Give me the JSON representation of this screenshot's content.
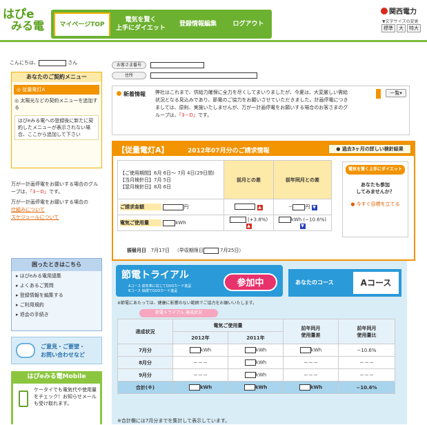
{
  "header": {
    "logo_line1": "はぴe",
    "logo_line2": "みる電",
    "nav": [
      "マイページTOP",
      "電気を賢く\n上手にダイエット",
      "登録情報編集",
      "ログアウト"
    ],
    "brand": "関西電力",
    "font_size_label": "文字サイズの変更",
    "font_sizes": [
      "標準",
      "大",
      "特大"
    ]
  },
  "sidebar": {
    "greeting_prefix": "こんにちは、",
    "greeting_suffix": "さん",
    "menu_title": "あなたのご契約メニュー",
    "menu_selected": "従量電灯A",
    "menu_items": [
      "太陽光などの契約メニューを追加する",
      "はぴeみる電への登録後に新たに契約したメニューが表示されない場合、ここから追加して下さい"
    ],
    "notice1": "万が一計画停電をお願いする場合のグループは、",
    "notice_group": "「3－D」",
    "notice1_end": "です。",
    "notice2": "万が一計画停電をお願いする場合の",
    "notice2_link1": "仕組みについて",
    "notice2_link2": "スケジュールについて",
    "trouble_title": "困ったときはこちら",
    "trouble_items": [
      "はぴeみる電用語集",
      "よくあるご質問",
      "登録情報を編集する",
      "ご利用規約",
      "退会の手続き"
    ],
    "contact": "ご意見・ご要望・\nお問い合わせなど",
    "mobile_title": "はぴeみる電Mobile",
    "mobile_text": "ケータイでも電気代や使用量をチェック！お知らせメールも受け取れます。"
  },
  "info": {
    "customer_no_label": "お客さま番号",
    "address_label": "住所"
  },
  "news": {
    "title": "新着情報",
    "body": "弊社はこれまで、供給力確保に全力を尽くしてまいりましたが、今夏は、大変厳しい需給状況となる見込みであり、節電のご協力をお願いさせていただきました。計画停電につきましては、原則、実施いたしませんが、万が一計画停電をお願いする場合のお客さまのグループは、",
    "body_group": "「3－D」",
    "body_end": "です。",
    "list_button": "一覧"
  },
  "bill": {
    "plan": "【従量電灯A】",
    "title": "2012年07月分のご請求情報",
    "history_button": "過去3ヶ月の詳しい検針結果",
    "period": "【ご使用期間】6月 6日～ 7月 4日(29日間)",
    "meter_date": "【当月検針日】7月 5日",
    "next_meter": "【翌月検針日】8月 6日",
    "col_prev": "前月との差",
    "col_prev_year": "前年同月との差",
    "row_amount": "ご請求金額",
    "row_usage": "電気ご使用量",
    "unit_yen": "円",
    "unit_kwh": "kWh",
    "usage_prev_pct": "(+3.8%)",
    "usage_year_pct": "(−10.6%)",
    "amount_year_prefix": "－",
    "payment_label": "振替月日",
    "payment_date": "7月17日",
    "early_label": "（早収期限日",
    "early_date": "7月25日）",
    "diet_button": "電気を賢く上手にダイエット",
    "diet_q": "あなたも参加\nしてみませんか？",
    "diet_link": "今すぐ目標を立てる"
  },
  "trial": {
    "title": "節電トライアル",
    "course_a": "Aコース 前年率に応じてQUOカード進呈",
    "course_b": "Bコース 抽選でQUOカード進呈",
    "badge": "参加中",
    "your_course": "あなたのコース",
    "course_value": "Aコース",
    "note": "※節電にあたっては、健康に影響のない範囲でご協力をお願いいたします。",
    "tag": "節電トライアル 達成状況",
    "h_status": "達成状況",
    "h_usage": "電気ご使用量",
    "h_2012": "2012年",
    "h_2011": "2011年",
    "h_diff": "前年同月\n使用量差",
    "h_ratio": "前年同月\n使用量比",
    "rows": [
      {
        "m": "7月分",
        "ratio": "−10.6%"
      },
      {
        "m": "8月分",
        "ratio": "－－－"
      },
      {
        "m": "9月分",
        "ratio": "－－－"
      }
    ],
    "total_label": "合計(※)",
    "total_ratio": "−10.6%",
    "dash": "－－－"
  },
  "footnote": "※合計欄には7月分までを集計して表示しています。"
}
